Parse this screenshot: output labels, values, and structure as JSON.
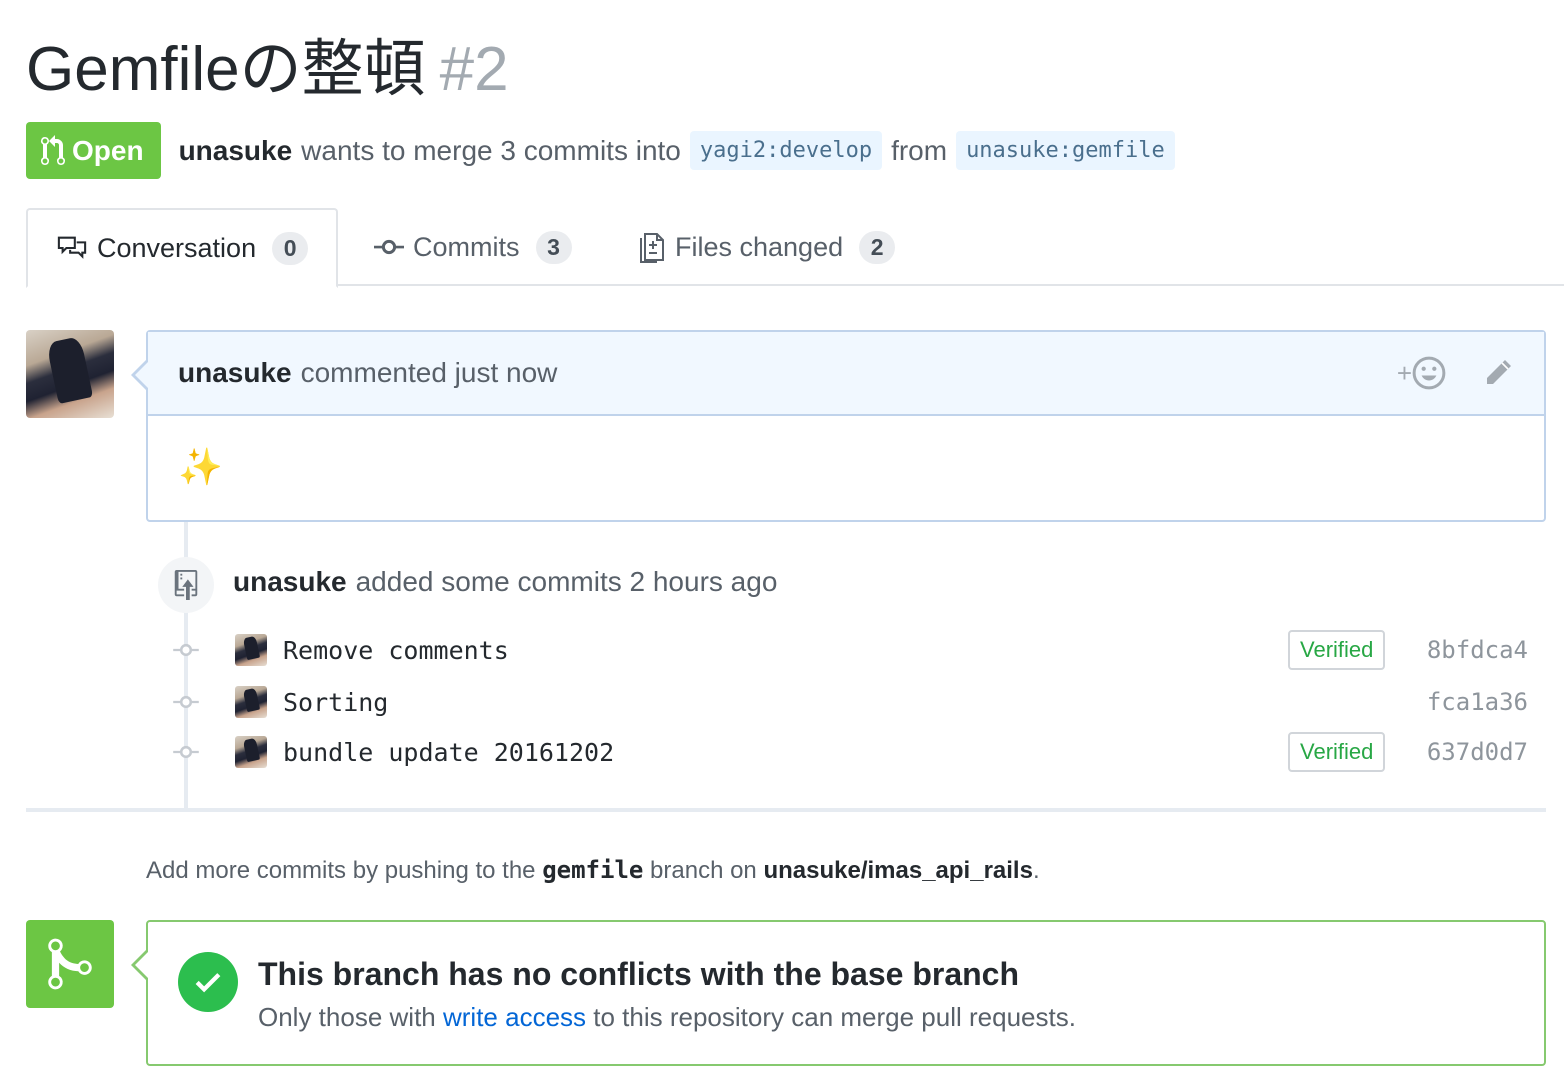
{
  "pr": {
    "title": "Gemfileの整頓",
    "number": "#2",
    "state": "Open",
    "author": "unasuke",
    "merge_text": "wants to merge 3 commits into",
    "base_branch": "yagi2:develop",
    "from_text": "from",
    "head_branch": "unasuke:gemfile"
  },
  "tabs": [
    {
      "label": "Conversation",
      "count": "0",
      "icon": "comment-discussion-icon"
    },
    {
      "label": "Commits",
      "count": "3",
      "icon": "git-commit-icon"
    },
    {
      "label": "Files changed",
      "count": "2",
      "icon": "file-diff-icon"
    }
  ],
  "comment": {
    "author": "unasuke",
    "action": "commented just now",
    "body": "✨",
    "reaction_label": "+"
  },
  "commits_event": {
    "author": "unasuke",
    "action": "added some commits 2 hours ago",
    "commits": [
      {
        "message": "Remove comments",
        "verified": "Verified",
        "sha": "8bfdca4"
      },
      {
        "message": "Sorting",
        "verified": "",
        "sha": "fca1a36"
      },
      {
        "message": "bundle update 20161202",
        "verified": "Verified",
        "sha": "637d0d7"
      }
    ]
  },
  "help": {
    "prefix": "Add more commits by pushing to the",
    "branch": "gemfile",
    "middle": "branch on",
    "repo": "unasuke/imas_api_rails",
    "suffix": "."
  },
  "merge": {
    "title": "This branch has no conflicts with the base branch",
    "sub_prefix": "Only those with",
    "sub_link": "write access",
    "sub_suffix": "to this repository can merge pull requests."
  },
  "colors": {
    "open_green": "#6cc644",
    "link_blue": "#0366d6",
    "verified_green": "#28a745",
    "comment_header_bg": "#f1f8ff"
  }
}
